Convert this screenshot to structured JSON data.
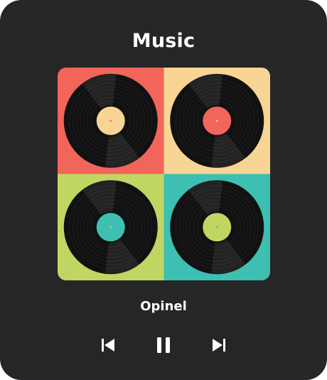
{
  "widget": {
    "title": "Music",
    "track_name": "Opinel"
  },
  "album_art": {
    "quadrants": [
      {
        "background": "#F1655A",
        "label": "#F8D594"
      },
      {
        "background": "#F8D594",
        "label": "#F1655A"
      },
      {
        "background": "#C0D662",
        "label": "#3DBFB1"
      },
      {
        "background": "#3DBFB1",
        "label": "#C0D662"
      }
    ]
  },
  "controls": {
    "previous_icon": "skip-previous-icon",
    "play_pause_icon": "pause-icon",
    "next_icon": "skip-next-icon"
  },
  "colors": {
    "card_background": "#262626",
    "text": "#FFFFFF",
    "vinyl": "#111111"
  }
}
